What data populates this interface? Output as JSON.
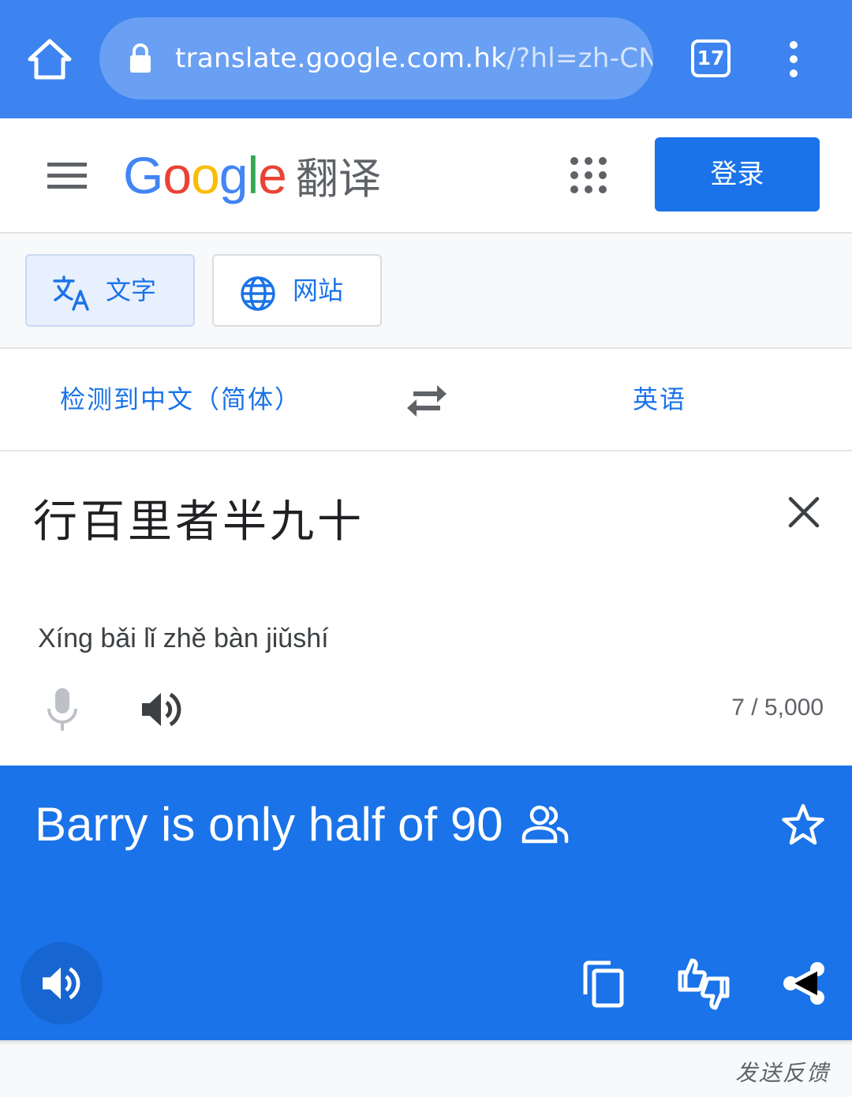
{
  "browser": {
    "url_main": "translate.google.com.hk",
    "url_rest": "/?hl=zh-CN&",
    "tab_count": "17",
    "icons": [
      "home-icon",
      "lock-icon",
      "tab-switcher",
      "kebab-menu-icon"
    ]
  },
  "header": {
    "logo_google": "Google",
    "logo_product": "翻译",
    "login_label": "登录",
    "icons": [
      "hamburger-icon",
      "apps-grid-icon"
    ]
  },
  "modes": {
    "text_label": "文字",
    "website_label": "网站",
    "active": "text"
  },
  "languages": {
    "source": "检测到中文（简体）",
    "target": "英语"
  },
  "source": {
    "text": "行百里者半九十",
    "pinyin": "Xíng bǎi lǐ zhě bàn jiǔshí",
    "char_count": "7 / 5,000"
  },
  "result": {
    "text": "Barry is only half of 90"
  },
  "footer": {
    "send_feedback": "发送反馈"
  },
  "colors": {
    "browser_bar": "#3d84f0",
    "url_pill": "#6aa0f4",
    "accent": "#1a73e8",
    "google_blue": "#4285f4",
    "google_red": "#ea4335",
    "google_yellow": "#fbbc05",
    "google_green": "#34a853"
  }
}
